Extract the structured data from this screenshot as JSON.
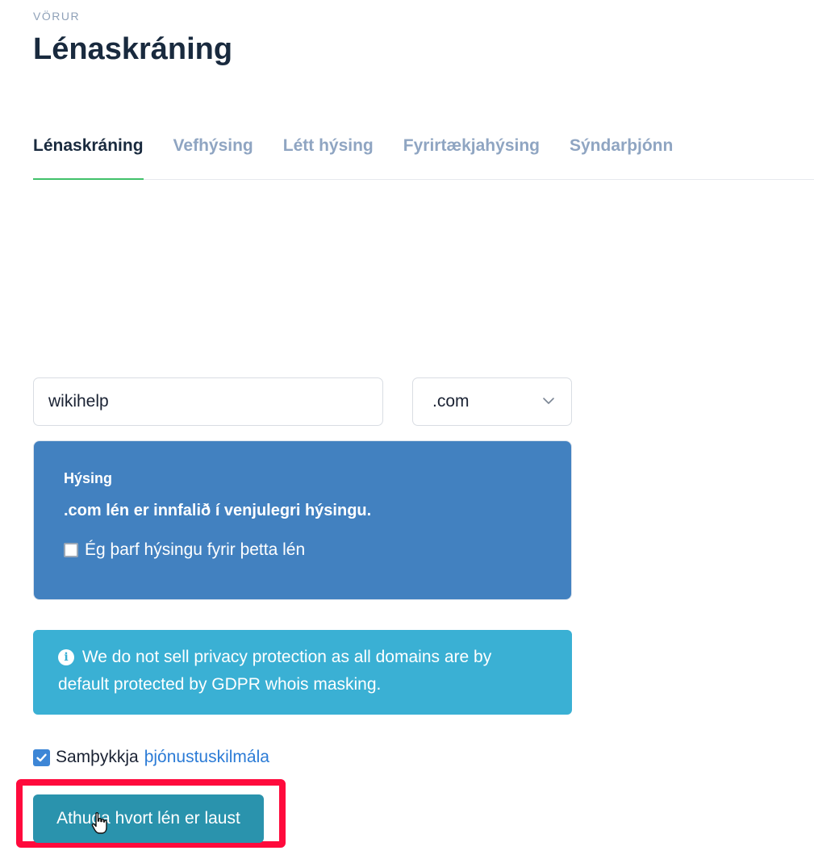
{
  "header": {
    "eyebrow": "VÖRUR",
    "title": "Lénaskráning"
  },
  "tabs": [
    {
      "label": "Lénaskráning",
      "active": true
    },
    {
      "label": "Vefhýsing",
      "active": false
    },
    {
      "label": "Létt hýsing",
      "active": false
    },
    {
      "label": "Fyrirtækjahýsing",
      "active": false
    },
    {
      "label": "Sýndarþjónn",
      "active": false
    }
  ],
  "search": {
    "domain_value": "wikihelp",
    "tld_selected": ".com"
  },
  "hosting": {
    "label": "Hýsing",
    "text": ".com lén er innfalið í venjulegri hýsingu.",
    "checkbox_label": "Ég þarf hýsingu fyrir þetta lén",
    "checked": false
  },
  "info": {
    "icon": "info-icon",
    "text": "We do not sell privacy protection as all domains are by default protected by GDPR whois masking."
  },
  "terms": {
    "label": "Samþykkja",
    "link": "þjónustuskilmála",
    "checked": true
  },
  "submit": {
    "label": "Athuga hvort lén er laust"
  },
  "colors": {
    "accent_green": "#41c16a",
    "hosting_blue": "#4281c0",
    "info_cyan": "#3ab0d4",
    "button_teal": "#2a93ad",
    "highlight_red": "#ff0a3c"
  }
}
